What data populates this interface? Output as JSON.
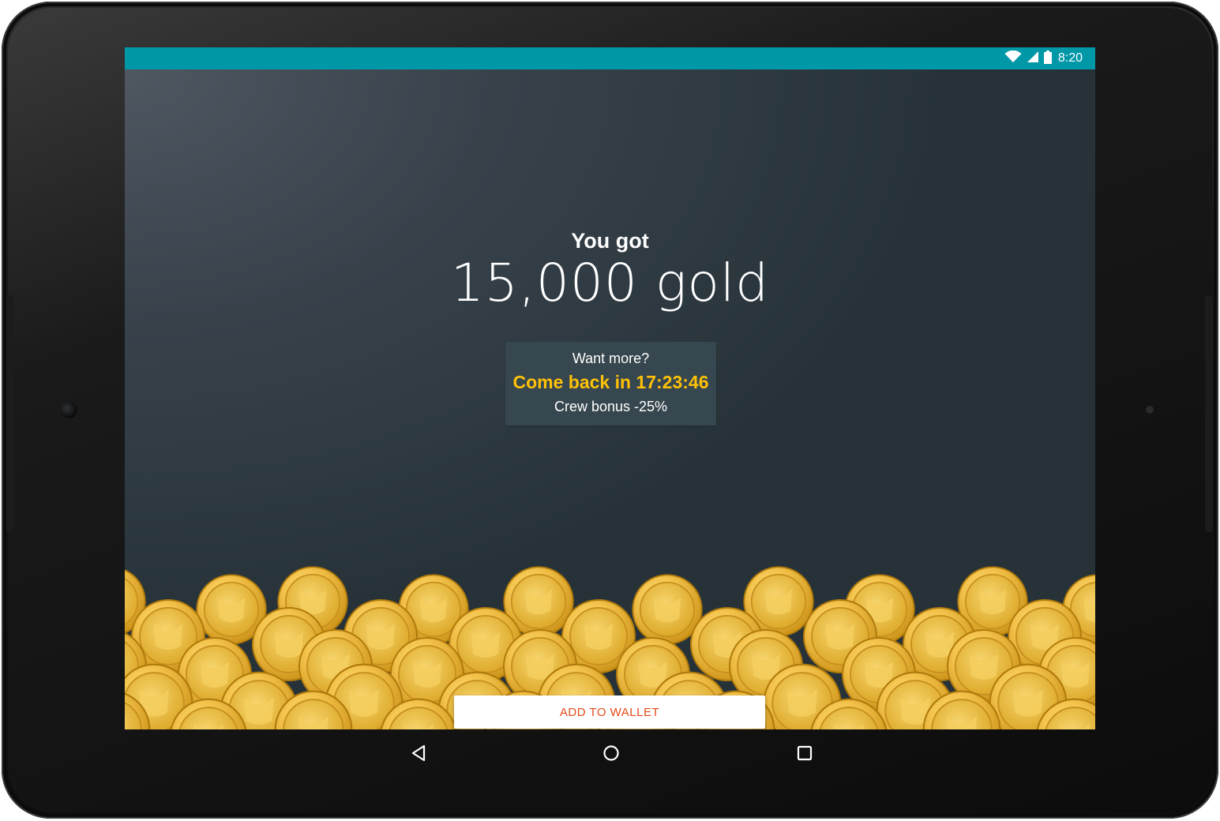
{
  "status_bar": {
    "time": "8:20",
    "icons": [
      "wifi-icon",
      "signal-icon",
      "battery-icon"
    ],
    "color": "#0097a7"
  },
  "reward": {
    "headline": "You got",
    "amount": "15,000 gold"
  },
  "info_box": {
    "line1": "Want more?",
    "line2": "Come back in 17:23:46",
    "line3": "Crew bonus -25%",
    "highlight_color": "#ffc107"
  },
  "actions": {
    "add_to_wallet_label": "ADD TO WALLET",
    "label_color": "#e64a19"
  },
  "nav_bar": {
    "icons": [
      "back-icon",
      "home-icon",
      "recents-icon"
    ]
  },
  "colors": {
    "background": "#263238",
    "coin_gold": "#f2c04a"
  }
}
